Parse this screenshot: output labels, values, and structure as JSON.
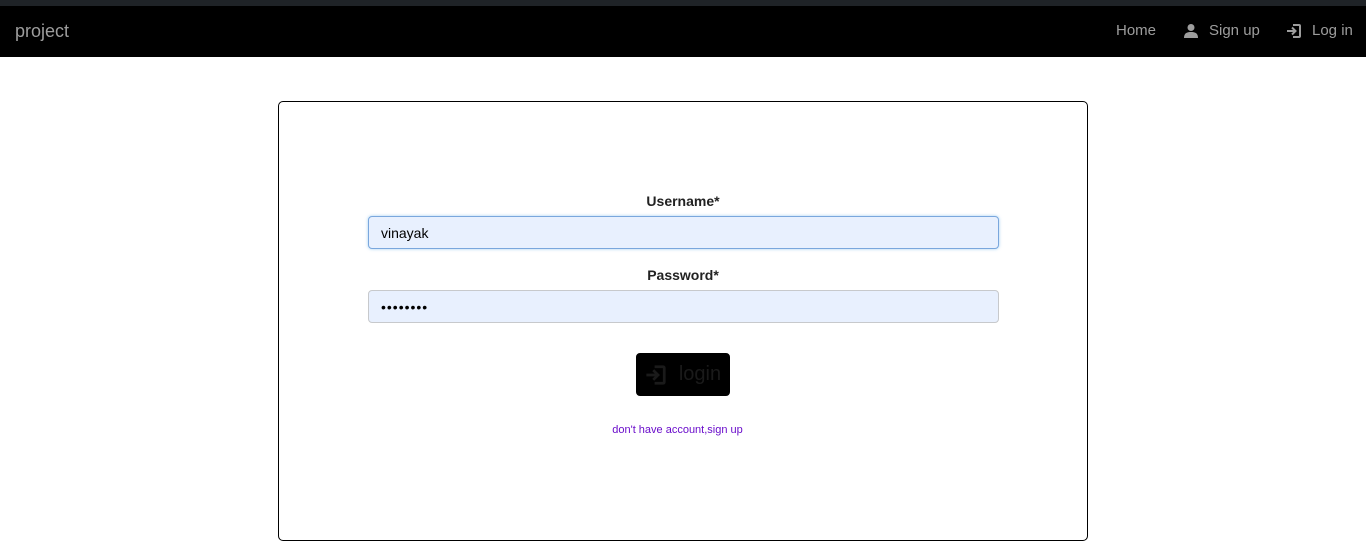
{
  "navbar": {
    "brand": "project",
    "links": [
      {
        "label": "Home",
        "icon": ""
      },
      {
        "label": "Sign up",
        "icon": "user-icon"
      },
      {
        "label": "Log in",
        "icon": "log-in-icon"
      }
    ]
  },
  "form": {
    "username_label": "Username*",
    "username_value": "vinayak",
    "password_label": "Password*",
    "password_value": "••••••••",
    "login_button": "login",
    "login_button_icon": "log-in-icon",
    "signup_link": "don't have account,sign up"
  },
  "colors": {
    "navbar_bg": "#000000",
    "nav_text": "#9d9d9d",
    "input_bg": "#e8f0fe",
    "link": "#6a0dcb"
  }
}
